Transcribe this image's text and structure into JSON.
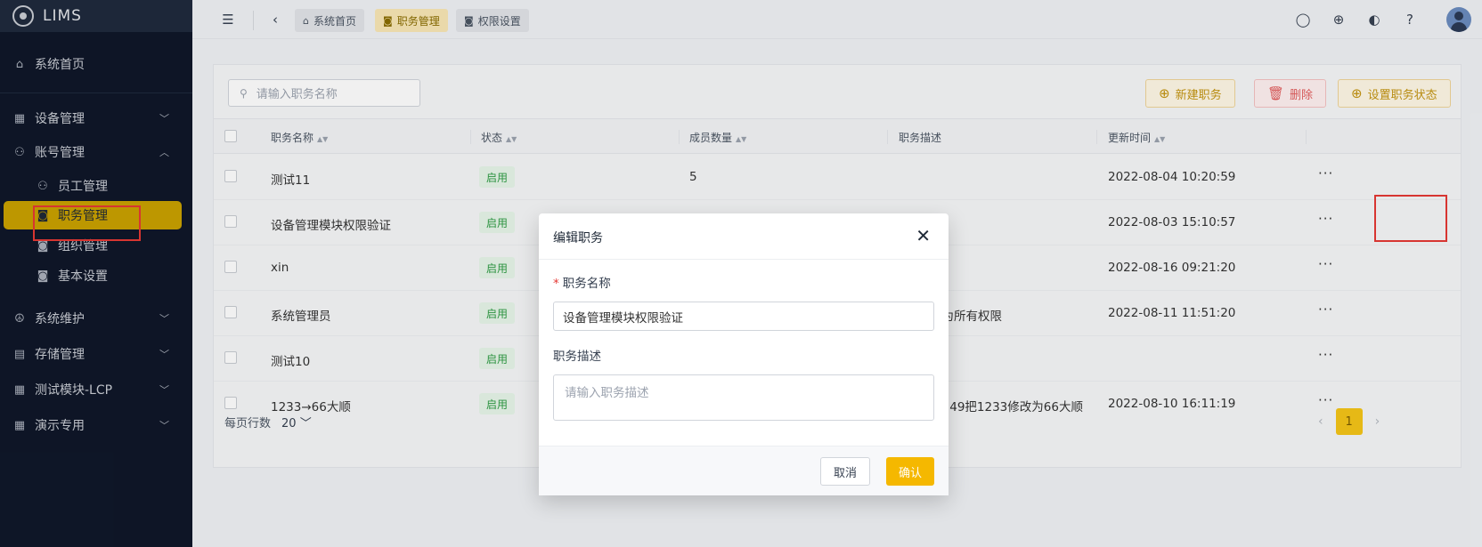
{
  "app": {
    "name": "LIMS"
  },
  "sidebar": {
    "items": [
      {
        "label": "系统首页",
        "icon": "home-icon"
      },
      {
        "label": "设备管理",
        "icon": "grid-icon"
      },
      {
        "label": "账号管理",
        "icon": "users-icon"
      },
      {
        "label": "员工管理",
        "icon": "users-icon"
      },
      {
        "label": "职务管理",
        "icon": "id-card-icon"
      },
      {
        "label": "组织管理",
        "icon": "id-card-icon"
      },
      {
        "label": "基本设置",
        "icon": "id-card-icon"
      },
      {
        "label": "系统维护",
        "icon": "peace-icon"
      },
      {
        "label": "存储管理",
        "icon": "storage-icon"
      },
      {
        "label": "测试模块-LCP",
        "icon": "grid-icon"
      },
      {
        "label": "演示专用",
        "icon": "grid-icon"
      }
    ]
  },
  "topbar": {
    "tabs": [
      {
        "label": "系统首页"
      },
      {
        "label": "职务管理"
      },
      {
        "label": "权限设置"
      }
    ]
  },
  "toolbar": {
    "search_placeholder": "请输入职务名称",
    "new_label": "新建职务",
    "delete_label": "删除",
    "status_label": "设置职务状态"
  },
  "table": {
    "headers": [
      "职务名称",
      "状态",
      "成员数量",
      "职务描述",
      "更新时间"
    ],
    "rows": [
      {
        "name": "测试11",
        "status": "启用",
        "members": "5",
        "desc": "",
        "time": "2022-08-04 10:20:59"
      },
      {
        "name": "设备管理模块权限验证",
        "status": "启用",
        "members": "",
        "desc": "",
        "time": "2022-08-03 15:10:57"
      },
      {
        "name": "xin",
        "status": "启用",
        "members": "",
        "desc": "",
        "time": "2022-08-16 09:21:20"
      },
      {
        "name": "系统管理员",
        "status": "启用",
        "members": "",
        "desc": "8.9设置为所有权限",
        "time": "2022-08-11 11:51:20"
      },
      {
        "name": "测试10",
        "status": "启用",
        "members": "",
        "desc": "",
        "time": ""
      },
      {
        "name": "1233→66大顺",
        "status": "启用",
        "members": "",
        "desc": "7-29-10:49把1233修改为66大顺",
        "time": "2022-08-10 16:11:19"
      }
    ]
  },
  "footer": {
    "rows_per_page_label": "每页行数",
    "page_size": "20",
    "current_page": "1"
  },
  "modal": {
    "title": "编辑职务",
    "name_label": "职务名称",
    "name_value": "设备管理模块权限验证",
    "desc_label": "职务描述",
    "desc_placeholder": "请输入职务描述",
    "cancel_label": "取消",
    "ok_label": "确认"
  },
  "colors": {
    "accent": "#f5b800",
    "sidebar_bg": "#0f1729",
    "active_nav": "#c9a100",
    "danger": "#e35d5d",
    "success": "#2f9d44"
  }
}
